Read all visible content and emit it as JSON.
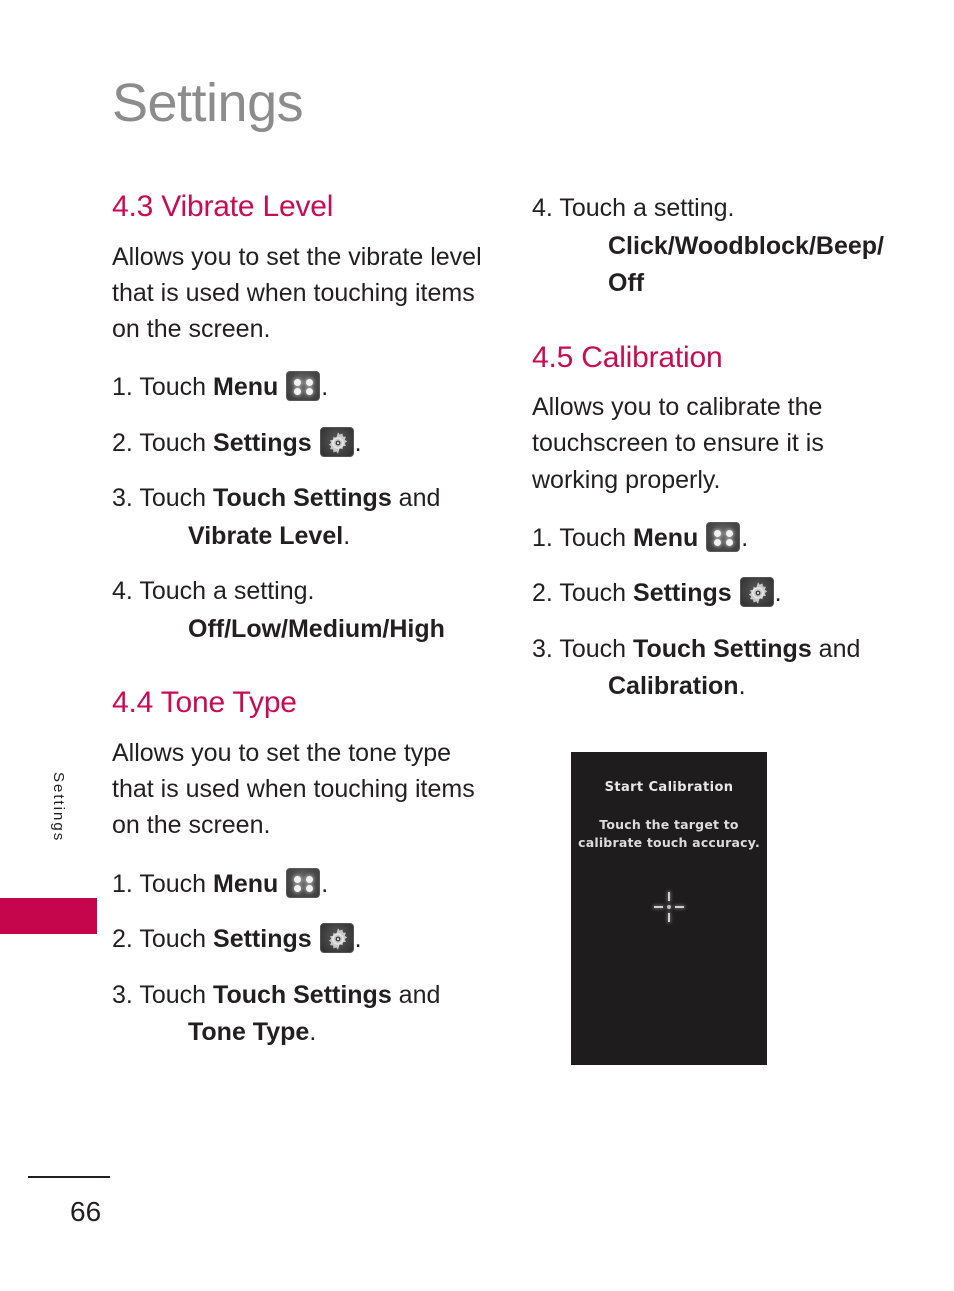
{
  "page": {
    "title": "Settings",
    "side_tab_label": "Settings",
    "number": "66",
    "accent_color": "#ca0a55",
    "tab_color": "#c5064c",
    "title_color": "#8c8c8c"
  },
  "left_column": {
    "sections": [
      {
        "heading": "4.3 Vibrate Level",
        "intro": "Allows you to set the vibrate level that is used when touching items on the screen.",
        "steps": [
          {
            "num": "1.",
            "pre": "Touch ",
            "bold": "Menu",
            "icon": "menu-grid-icon",
            "post": "."
          },
          {
            "num": "2.",
            "pre": "Touch ",
            "bold": "Settings",
            "icon": "gear-icon",
            "post": "."
          },
          {
            "num": "3.",
            "pre": "Touch ",
            "bold": "Touch Settings",
            "mid": " and",
            "cont_bold": "Vibrate Level",
            "cont_post": "."
          },
          {
            "num": "4.",
            "pre": "Touch a setting.",
            "cont_strong": "Off/Low/Medium/High"
          }
        ]
      },
      {
        "heading": "4.4 Tone Type",
        "intro": "Allows you to set the tone type that is used when touching items on the screen.",
        "steps": [
          {
            "num": "1.",
            "pre": "Touch ",
            "bold": "Menu",
            "icon": "menu-grid-icon",
            "post": "."
          },
          {
            "num": "2.",
            "pre": "Touch ",
            "bold": "Settings",
            "icon": "gear-icon",
            "post": "."
          },
          {
            "num": "3.",
            "pre": "Touch ",
            "bold": "Touch Settings",
            "mid": " and",
            "cont_bold": "Tone Type",
            "cont_post": "."
          }
        ]
      }
    ]
  },
  "right_column": {
    "continued_step": {
      "num": "4.",
      "pre": "Touch a setting.",
      "cont_strong": "Click/Woodblock/Beep/ Off"
    },
    "sections": [
      {
        "heading": "4.5 Calibration",
        "intro": "Allows you to calibrate the touchscreen to ensure it is working properly.",
        "steps": [
          {
            "num": "1.",
            "pre": "Touch ",
            "bold": "Menu",
            "icon": "menu-grid-icon",
            "post": "."
          },
          {
            "num": "2.",
            "pre": "Touch ",
            "bold": "Settings",
            "icon": "gear-icon",
            "post": "."
          },
          {
            "num": "3.",
            "pre": "Touch ",
            "bold": "Touch Settings",
            "mid": " and",
            "cont_bold": "Calibration",
            "cont_post": "."
          }
        ]
      }
    ]
  },
  "calibration_screenshot": {
    "title": "Start Calibration",
    "instruction_line1": "Touch the target to",
    "instruction_line2": "calibrate touch accuracy.",
    "target_icon": "crosshair-target-icon",
    "background_color": "#1e1c1c"
  }
}
